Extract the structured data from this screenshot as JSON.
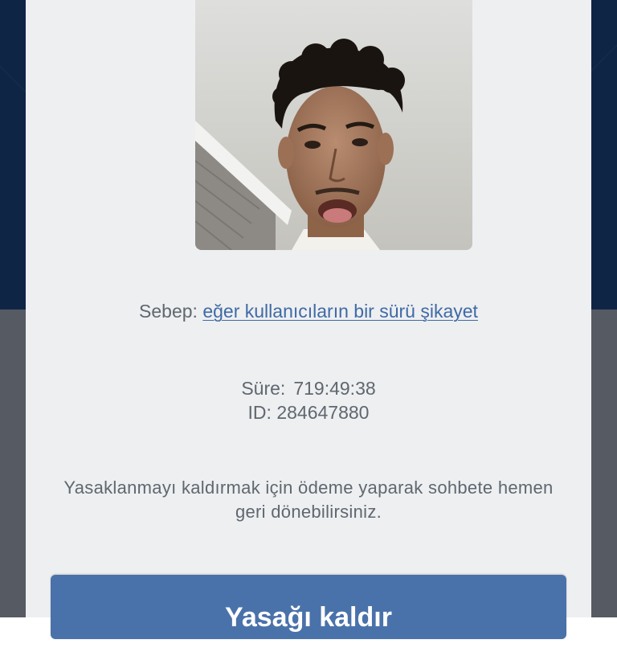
{
  "ban_screen": {
    "reason_label": "Sebep:",
    "reason_value": "eğer kullanıcıların bir sürü şikayet",
    "duration_label": "Süre:",
    "duration_value": "719:49:38",
    "id_label": "ID:",
    "id_value": "284647880",
    "notice": "Yasaklanmayı kaldırmak için ödeme yaparak sohbete hemen geri dönebilirsiniz.",
    "action_button_label": "Yasağı kaldır"
  },
  "colors": {
    "header_bg": "#0f2545",
    "overlay_bg": "#565a63",
    "card_bg": "#eeeff0",
    "link": "#3f6aa6",
    "button_bg": "#4a72aa",
    "text": "#5f6770"
  }
}
